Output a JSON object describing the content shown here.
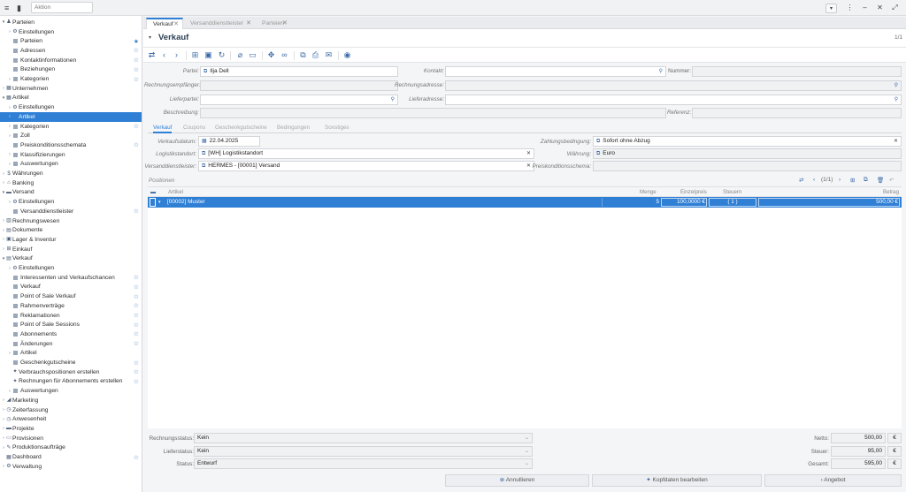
{
  "topbar": {
    "action_placeholder": "Aktion"
  },
  "sidebar": {
    "items": [
      {
        "label": "Parteien"
      },
      {
        "label": "Einstellungen"
      },
      {
        "label": "Parteien"
      },
      {
        "label": "Adressen"
      },
      {
        "label": "Kontaktinformationen"
      },
      {
        "label": "Beziehungen"
      },
      {
        "label": "Kategorien"
      },
      {
        "label": "Unternehmen"
      },
      {
        "label": "Artikel"
      },
      {
        "label": "Einstellungen"
      },
      {
        "label": "Artikel"
      },
      {
        "label": "Kategorien"
      },
      {
        "label": "Zoll"
      },
      {
        "label": "Preiskonditionsschemata"
      },
      {
        "label": "Klassifizierungen"
      },
      {
        "label": "Auswertungen"
      },
      {
        "label": "Währungen"
      },
      {
        "label": "Banking"
      },
      {
        "label": "Versand"
      },
      {
        "label": "Einstellungen"
      },
      {
        "label": "Versanddienstleister"
      },
      {
        "label": "Rechnungswesen"
      },
      {
        "label": "Dokumente"
      },
      {
        "label": "Lager & Inventur"
      },
      {
        "label": "Einkauf"
      },
      {
        "label": "Verkauf"
      },
      {
        "label": "Einstellungen"
      },
      {
        "label": "Interessenten und Verkaufschancen"
      },
      {
        "label": "Verkauf"
      },
      {
        "label": "Point of Sale Verkauf"
      },
      {
        "label": "Rahmenverträge"
      },
      {
        "label": "Reklamationen"
      },
      {
        "label": "Point of Sale Sessions"
      },
      {
        "label": "Abonnements"
      },
      {
        "label": "Änderungen"
      },
      {
        "label": "Artikel"
      },
      {
        "label": "Geschenkgutscheine"
      },
      {
        "label": "Verbrauchspositionen erstellen"
      },
      {
        "label": "Rechnungen für Abonnements erstellen"
      },
      {
        "label": "Auswertungen"
      },
      {
        "label": "Marketing"
      },
      {
        "label": "Zeiterfassung"
      },
      {
        "label": "Anwesenheit"
      },
      {
        "label": "Projekte"
      },
      {
        "label": "Provisionen"
      },
      {
        "label": "Produktionsaufträge"
      },
      {
        "label": "Dashboard"
      },
      {
        "label": "Verwaltung"
      }
    ]
  },
  "tabs": [
    {
      "label": "Verkauf"
    },
    {
      "label": "Versanddienstleister"
    },
    {
      "label": "Parteien"
    }
  ],
  "header": {
    "title": "Verkauf",
    "counter": "1/1"
  },
  "form": {
    "partei_label": "Partei:",
    "partei": "Ilja Dell",
    "kontakt_label": "Kontakt:",
    "nummer_label": "Nummer:",
    "rechnungsempfaenger_label": "Rechnungsempfänger:",
    "rechnungsadresse_label": "Rechnungsadresse:",
    "lieferpartei_label": "Lieferpartei:",
    "lieferadresse_label": "Lieferadresse:",
    "beschreibung_label": "Beschreibung:",
    "referenz_label": "Referenz:"
  },
  "subtabs": [
    {
      "label": "Verkauf"
    },
    {
      "label": "Coupons"
    },
    {
      "label": "Geschenkgutscheine"
    },
    {
      "label": "Bedingungen"
    },
    {
      "label": "Sonstiges"
    }
  ],
  "verkauf": {
    "verkaufsdatum_label": "Verkaufsdatum:",
    "verkaufsdatum": "22.04.2025",
    "zahlungsbedingung_label": "Zahlungsbedingung:",
    "zahlungsbedingung": "Sofort ohne Abzug",
    "logistikstandort_label": "Logistikstandort:",
    "logistikstandort": "[WH] Logistikstandort",
    "waehrung_label": "Währung:",
    "waehrung": "Euro",
    "versanddienstleister_label": "Versanddienstleister:",
    "versanddienstleister": "HERMES - [00001] Versand",
    "preiskonditionsschema_label": "Preiskonditionsschema:"
  },
  "positions": {
    "title": "Positionen",
    "pager": "(1/1)",
    "columns": {
      "artikel": "Artikel",
      "menge": "Menge",
      "einzelpreis": "Einzelpreis",
      "steuern": "Steuern",
      "betrag": "Betrag"
    },
    "rows": [
      {
        "artikel": "[00002] Muster",
        "menge": "5",
        "einzelpreis": "100,0000 €",
        "steuern": "( 1 )",
        "betrag": "500,00 €"
      }
    ]
  },
  "status": {
    "rechnungsstatus_label": "Rechnungsstatus:",
    "rechnungsstatus": "Kein",
    "lieferstatus_label": "Lieferstatus:",
    "lieferstatus": "Kein",
    "status_label": "Status:",
    "status": "Entwurf"
  },
  "totals": {
    "netto_label": "Netto:",
    "netto": "500,00",
    "steuer_label": "Steuer:",
    "steuer": "95,00",
    "gesamt_label": "Gesamt:",
    "gesamt": "595,00",
    "currency": "€"
  },
  "buttons": {
    "annullieren": "Annullieren",
    "kopfdaten": "Kopfdaten bearbeiten",
    "angebot": "Angebot"
  },
  "colors": {
    "accent": "#2f7fd5",
    "icon": "#3c6aa6"
  }
}
